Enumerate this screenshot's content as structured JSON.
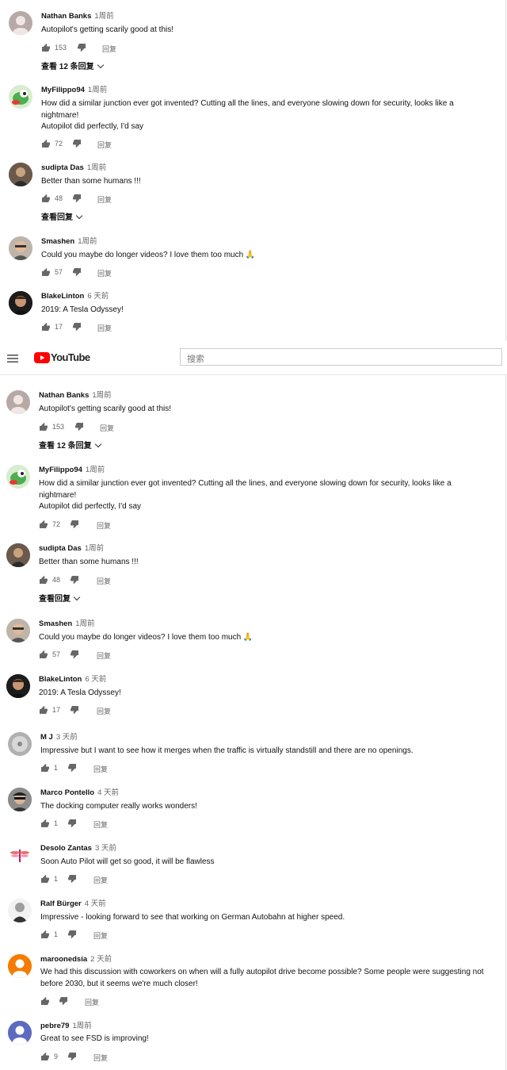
{
  "header": {
    "brand": "YouTube",
    "search_placeholder": "搜索"
  },
  "colors": {
    "brand_red": "#ff0000",
    "text": "#111111",
    "muted": "#666666"
  },
  "top_comments": [
    {
      "author": "Nathan Banks",
      "time": "1周前",
      "text": "Autopilot's getting scarily good at this!",
      "likes": "153",
      "reply": "回复",
      "view_replies": "查看 12 条回复"
    },
    {
      "author": "MyFilippo94",
      "time": "1周前",
      "text": "How did a similar junction ever got invented? Cutting all the lines, and everyone slowing down for security,  looks like a nightmare!\nAutopilot did perfectly, I'd say",
      "likes": "72",
      "reply": "回复"
    },
    {
      "author": "sudipta Das",
      "time": "1周前",
      "text": "Better than some humans !!!",
      "likes": "48",
      "reply": "回复",
      "view_replies": "查看回复"
    },
    {
      "author": "Smashen",
      "time": "1周前",
      "text": "Could you maybe do longer videos? I love them too much 🙏",
      "likes": "57",
      "reply": "回复"
    },
    {
      "author": "BlakeLinton",
      "time": "6 天前",
      "text": "2019: A Tesla Odyssey!",
      "likes": "17",
      "reply": "回复"
    }
  ],
  "bottom_comments": [
    {
      "author": "Nathan Banks",
      "time": "1周前",
      "text": "Autopilot's getting scarily good at this!",
      "likes": "153",
      "reply": "回复",
      "view_replies": "查看 12 条回复"
    },
    {
      "author": "MyFilippo94",
      "time": "1周前",
      "text": "How did a similar junction ever got invented? Cutting all the lines, and everyone slowing down for security,  looks like a nightmare!\nAutopilot did perfectly, I'd say",
      "likes": "72",
      "reply": "回复"
    },
    {
      "author": "sudipta Das",
      "time": "1周前",
      "text": "Better than some humans !!!",
      "likes": "48",
      "reply": "回复",
      "view_replies": "查看回复"
    },
    {
      "author": "Smashen",
      "time": "1周前",
      "text": "Could you maybe do longer videos? I love them too much 🙏",
      "likes": "57",
      "reply": "回复"
    },
    {
      "author": "BlakeLinton",
      "time": "6 天前",
      "text": "2019: A Tesla Odyssey!",
      "likes": "17",
      "reply": "回复"
    },
    {
      "author": "M J",
      "time": "3 天前",
      "text": "Impressive but I want to see how it merges when the traffic is virtually standstill and there are no openings.",
      "likes": "1",
      "reply": "回复"
    },
    {
      "author": "Marco Pontello",
      "time": "4 天前",
      "text": "The docking computer really works wonders!",
      "likes": "1",
      "reply": "回复"
    },
    {
      "author": "Desolo Zantas",
      "time": "3 天前",
      "text": "Soon Auto Pilot will get so good, it will be flawless",
      "likes": "1",
      "reply": "回复"
    },
    {
      "author": "Ralf Bürger",
      "time": "4 天前",
      "text": "Impressive - looking forward to see that working on German Autobahn at higher speed.",
      "likes": "1",
      "reply": "回复"
    },
    {
      "author": "maroonedsia",
      "time": "2 天前",
      "text": "We had this discussion with coworkers on when will a fully autopilot drive become possible? Some people were suggesting not before 2030, but it seems we're much closer!",
      "likes": "",
      "reply": "回复"
    },
    {
      "author": "pebre79",
      "time": "1周前",
      "text": "Great to see FSD is improving!",
      "likes": "9",
      "reply": "回复"
    }
  ]
}
